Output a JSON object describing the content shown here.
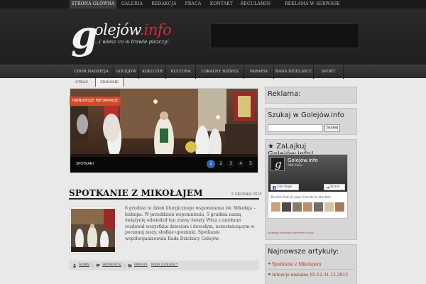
{
  "top_nav": {
    "items": [
      {
        "label": "STRONA GŁÓWNA",
        "active": true
      },
      {
        "label": "GALERIA",
        "active": false
      },
      {
        "label": "REDAKCJA",
        "active": false
      },
      {
        "label": "PRACA",
        "active": false
      },
      {
        "label": "KONTAKT",
        "active": false
      },
      {
        "label": "REGULAMIN",
        "active": false
      },
      {
        "label": "REKLAMA W SERWISIE",
        "active": false
      }
    ]
  },
  "header": {
    "logo_letter": "g",
    "logo_text": "olejów",
    "logo_suffix": ".info",
    "tagline": "...i wiesz co w trawie piszczy!"
  },
  "category_nav": {
    "items": [
      "CHÓR NADZIEJA",
      "GOLEJÓW",
      "KOŁO EIR",
      "KULTURA",
      "LOKALNY BIZNES",
      "PARAFIA",
      "RADA DZIELNICY",
      "SPORT"
    ]
  },
  "sub_nav": {
    "items": [
      "STRAŻ",
      "ZDROWIE"
    ]
  },
  "slider": {
    "badge": "NAJNOWSZE INFORMACJE:",
    "slide_title": "SPOTKANI",
    "pages": [
      "1",
      "2",
      "3",
      "4",
      "5"
    ],
    "active_page": "1"
  },
  "article": {
    "title": "SPOTKANIE Z MIKOŁAJEM",
    "date": "5 GRUDNIA 2015",
    "body": "6 grudnia to dzień liturgicznego wspomnienia św. Mikołaja – biskupa. W przeddzień wspomnienia, 5 grudnia naszą świątynię odwiedził ten znany święty Wraz z aniołami rozdawał wszystkim dzieciom i dorosłym, uczestniczącym w porannej mszy, słodkie upominki. Spotkanie współorganizowała Rada Dzielnicy Golejów.",
    "meta": {
      "author": "ADMIN",
      "comments": "SKOMENTUJ",
      "categories": [
        "PARAFIA",
        "RADA DZIELNICY"
      ]
    }
  },
  "sidebar": {
    "reklama_title": "Reklama:",
    "search": {
      "title": "Szukaj w Golejów.info",
      "placeholder": "",
      "button_label": "Szukaj"
    },
    "facebook": {
      "title": "★ ZaLajkuj Golejów.info!",
      "page_name": "Golejów.info",
      "likes": "990 likes",
      "like_label": "Like Page",
      "share_label": "Share",
      "friends_text": "Be the first of your friends to like this",
      "plugin_text": "Facebook Members WordPress Plugin"
    },
    "newest": {
      "title": "Najnowsze artykuły:",
      "posts": [
        "Spotkanie z Mikołajem",
        "Intencje mszalne 05.12-31.12.2015"
      ]
    }
  },
  "colors": {
    "accent_red": "#d8293e",
    "badge_orange": "#d2492b",
    "active_page_blue": "#2f63b5",
    "link_red": "#b42222"
  }
}
